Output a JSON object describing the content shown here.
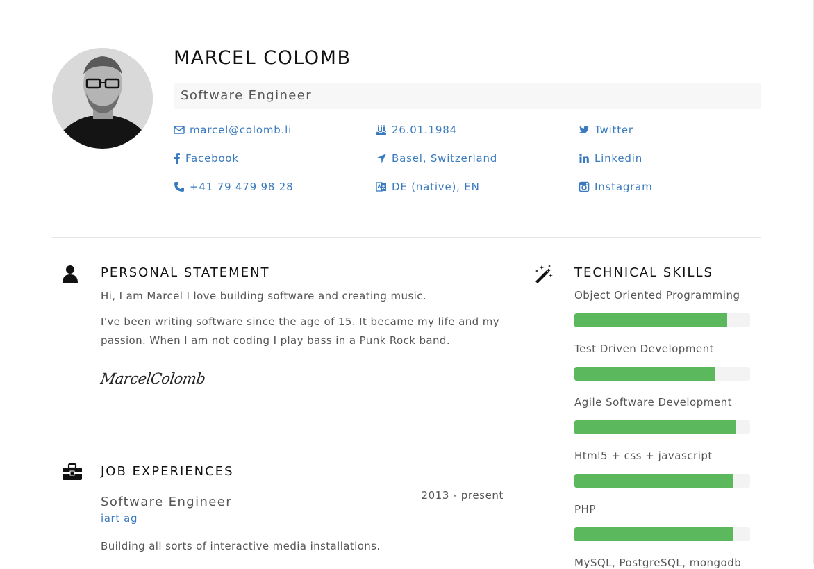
{
  "header": {
    "name": "MARCEL COLOMB",
    "title": "Software Engineer"
  },
  "contacts": [
    {
      "icon": "envelope-icon",
      "text": "marcel@colomb.li"
    },
    {
      "icon": "birthday-cake-icon",
      "text": "26.01.1984"
    },
    {
      "icon": "twitter-icon",
      "text": "Twitter"
    },
    {
      "icon": "facebook-icon",
      "text": "Facebook"
    },
    {
      "icon": "location-arrow-icon",
      "text": "Basel, Switzerland"
    },
    {
      "icon": "linkedin-icon",
      "text": "Linkedin"
    },
    {
      "icon": "phone-icon",
      "text": "+41 79 479 98 28"
    },
    {
      "icon": "language-icon",
      "text": "DE (native), EN"
    },
    {
      "icon": "instagram-icon",
      "text": "Instagram"
    }
  ],
  "statement": {
    "heading": "PERSONAL STATEMENT",
    "p1": "Hi, I am Marcel I love building software and creating music.",
    "p2_line1": "I've been writing software since the age of 15. It became my life and my",
    "p2_line2": "passion. When I am not coding I play bass in a Punk Rock band.",
    "signature": "MarcelColomb"
  },
  "jobs": {
    "heading": "JOB EXPERIENCES",
    "items": [
      {
        "title": "Software Engineer",
        "company": "iart ag",
        "dates": "2013 - present",
        "description": "Building all sorts of interactive media installations."
      }
    ]
  },
  "skills": {
    "heading": "TECHNICAL SKILLS",
    "items": [
      {
        "label": "Object Oriented Programming",
        "level": 0.87
      },
      {
        "label": "Test Driven Development",
        "level": 0.8
      },
      {
        "label": "Agile Software Development",
        "level": 0.92
      },
      {
        "label": "Html5 + css + javascript",
        "level": 0.9
      },
      {
        "label": "PHP",
        "level": 0.9
      },
      {
        "label": "MySQL, PostgreSQL, mongodb"
      }
    ]
  },
  "colors": {
    "link": "#3a7bbf",
    "skill_bar": "#5cb85c",
    "title_bar_bg": "#f7f7f7"
  }
}
